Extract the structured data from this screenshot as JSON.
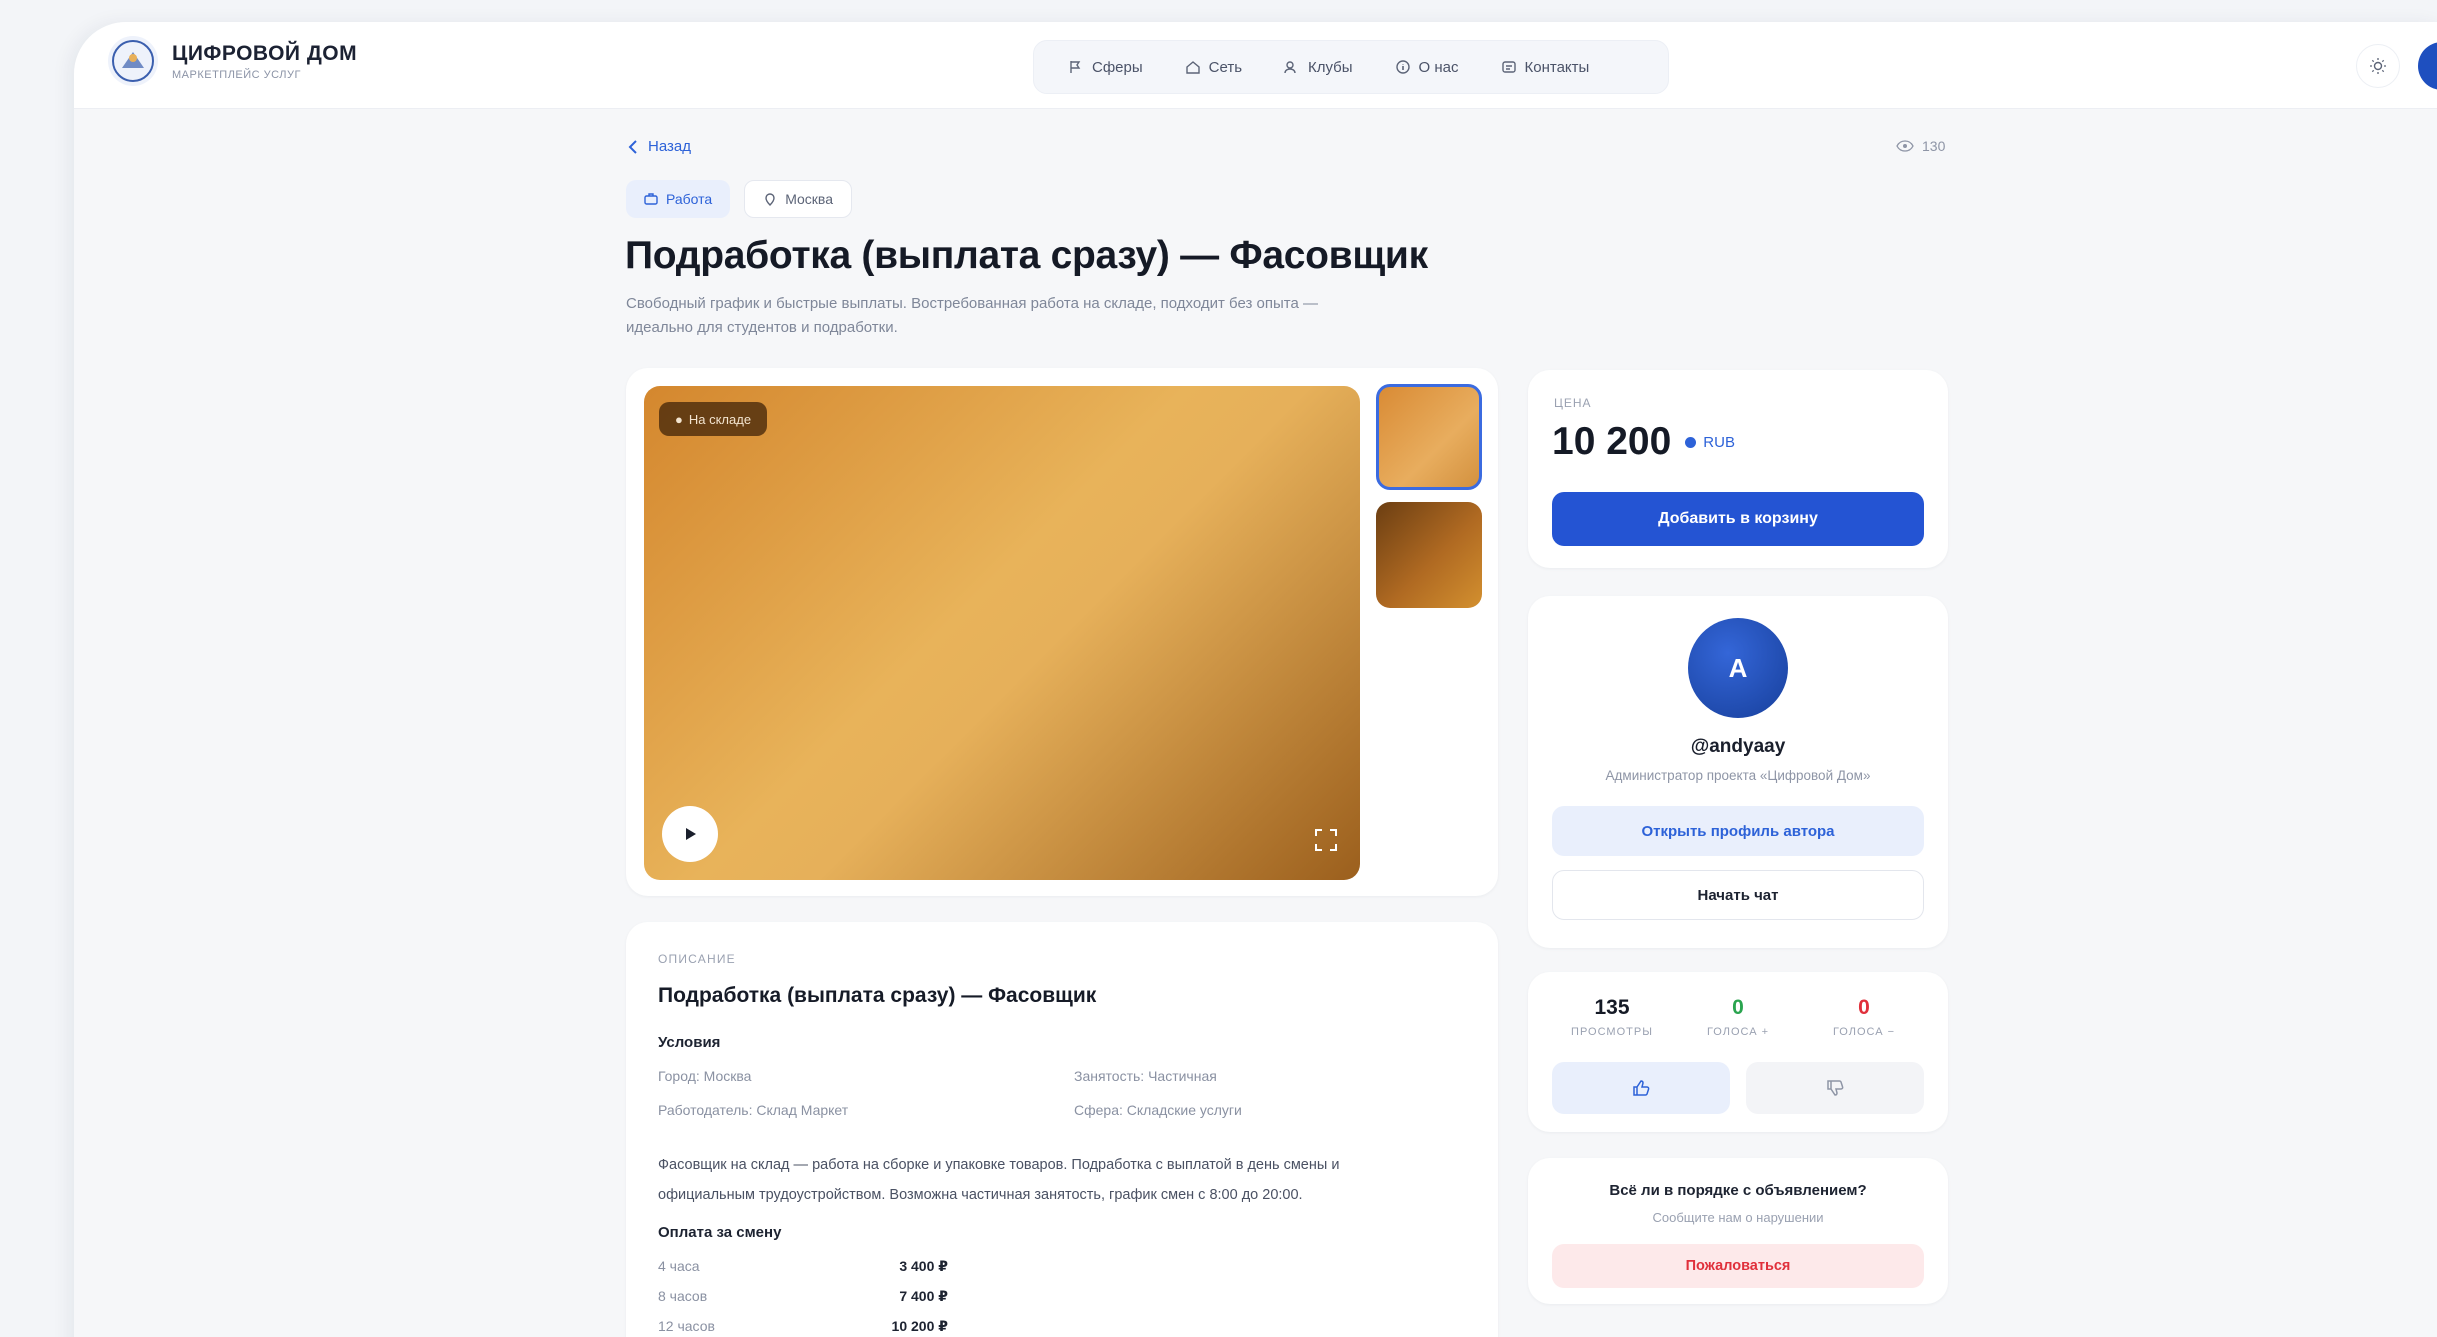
{
  "header": {
    "logo_title": "ЦИФРОВОЙ ДОМ",
    "logo_subtitle": "МАРКЕТПЛЕЙС УСЛУГ",
    "nav": [
      {
        "label": "Сферы",
        "icon": "spheres-icon"
      },
      {
        "label": "Сеть",
        "icon": "home-icon"
      },
      {
        "label": "Клубы",
        "icon": "clubs-icon"
      },
      {
        "label": "О нас",
        "icon": "info-icon"
      },
      {
        "label": "Контакты",
        "icon": "contacts-icon"
      }
    ]
  },
  "breadcrumb": {
    "back_label": "Назад"
  },
  "views": {
    "count": "130"
  },
  "chips": [
    {
      "label": "Работа",
      "icon": "work-icon"
    },
    {
      "label": "Москва",
      "icon": "location-icon"
    }
  ],
  "page": {
    "title": "Подработка (выплата сразу) — Фасовщик",
    "description": "Свободный график и быстрые выплаты. Востребованная работа на складе, подходит без опыта — идеально для студентов и подработки."
  },
  "media": {
    "badge": "На складе"
  },
  "description_card": {
    "label": "ОПИСАНИЕ",
    "title": "Подработка (выплата сразу) — Фасовщик",
    "conditions_title": "Условия",
    "conditions": [
      "Город: Москва",
      "Занятость: Частичная",
      "Работодатель: Склад Маркет",
      "Сфера: Складские услуги"
    ],
    "paragraph": "Фасовщик на склад — работа на сборке и упаковке товаров. Подработка с выплатой в день смены и официальным трудоустройством. Возможна частичная занятость, график смен с 8:00 до 20:00.",
    "pay_title": "Оплата за смену",
    "pay": [
      {
        "label": "4 часа",
        "value": "3 400 ₽"
      },
      {
        "label": "8 часов",
        "value": "7 400 ₽"
      },
      {
        "label": "12 часов",
        "value": "10 200 ₽"
      }
    ]
  },
  "price_card": {
    "label": "ЦЕНА",
    "price": "10 200",
    "currency": "RUB",
    "cart_button": "Добавить в корзину"
  },
  "author": {
    "initial": "A",
    "name": "@andyaay",
    "role": "Администратор проекта «Цифровой Дом»",
    "profile_button": "Открыть профиль автора",
    "chat_button": "Начать чат"
  },
  "stats": [
    {
      "value": "135",
      "label": "ПРОСМОТРЫ",
      "color": "#151a26"
    },
    {
      "value": "0",
      "label": "ГОЛОСА +",
      "color": "#2aa44f"
    },
    {
      "value": "0",
      "label": "ГОЛОСА −",
      "color": "#e0303b"
    }
  ],
  "report": {
    "title": "Всё ли в порядке с объявлением?",
    "subtitle": "Сообщите нам о нарушении",
    "button": "Пожаловаться"
  }
}
